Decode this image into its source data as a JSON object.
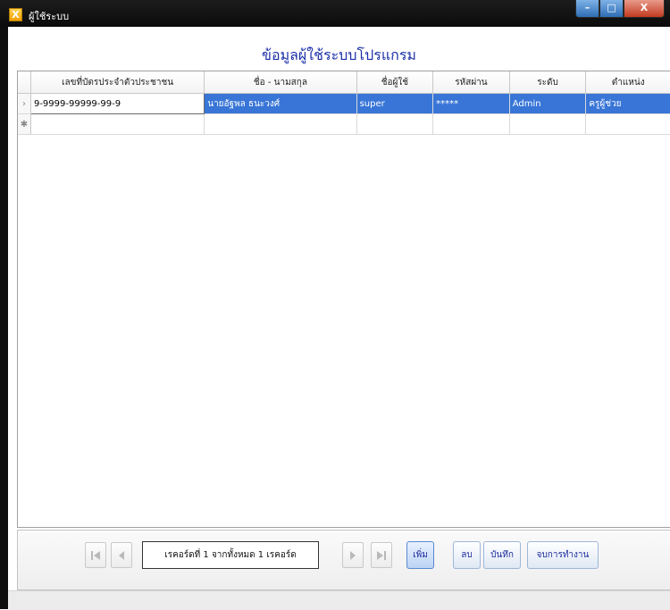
{
  "window": {
    "title": "ผู้ใช้ระบบ",
    "icon": "app-icon"
  },
  "page": {
    "heading": "ข้อมูลผู้ใช้ระบบโปรแกรม"
  },
  "grid": {
    "columns": [
      "เลขที่บัตรประจำตัวประชาชน",
      "ชื่อ - นามสกุล",
      "ชื่อผู้ใช้",
      "รหัสผ่าน",
      "ระดับ",
      "ตำแหน่ง"
    ],
    "rows": [
      {
        "id_card": "9-9999-99999-99-9",
        "full_name": "นายอัฐพล ธนะวงศ์",
        "username": "super",
        "password": "*****",
        "level": "Admin",
        "position": "ครูผู้ช่วย"
      }
    ],
    "current_row_indicator": "›",
    "new_row_indicator": "✱"
  },
  "navigator": {
    "record_text": "เรคอร์ดที่ 1 จากทั้งหมด 1 เรคอร์ด",
    "first_icon": "first-record-icon",
    "prev_icon": "prev-record-icon",
    "next_icon": "next-record-icon",
    "last_icon": "last-record-icon"
  },
  "actions": {
    "add": "เพิ่ม",
    "delete": "ลบ",
    "save": "บันทึก",
    "exit": "จบการทำงาน"
  },
  "colors": {
    "heading": "#1a2fa8",
    "selection": "#3875d7",
    "titlebar": "#111111"
  }
}
